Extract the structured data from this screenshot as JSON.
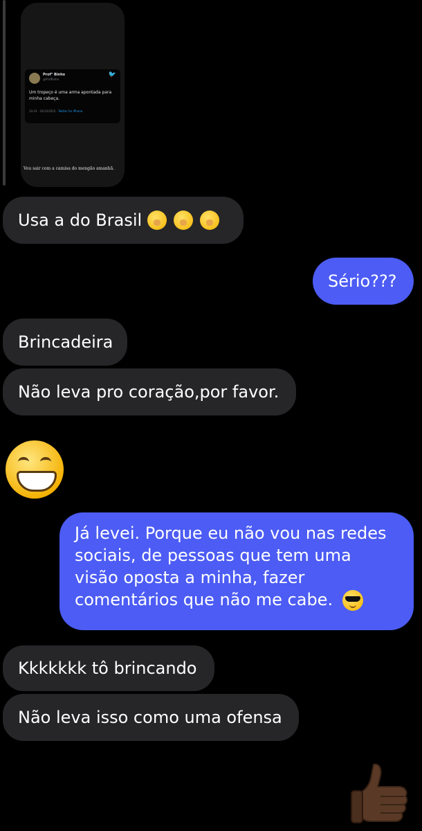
{
  "shared_media": {
    "tweet": {
      "name": "Prof° Binho",
      "handle": "@ProfBinho",
      "text": "Um tropeço é uma arma apontada para minha cabeça.",
      "meta": "10:43 · 20/10/2022 ·",
      "source": "Twitter for iPhone"
    },
    "caption": "Vou sair com a camisa do mengão amanhã."
  },
  "messages": [
    {
      "side": "in",
      "text": "Usa a do Brasil"
    },
    {
      "side": "out",
      "text": "Sério???"
    },
    {
      "side": "in",
      "text": "Brincadeira"
    },
    {
      "side": "in",
      "text": "Não leva pro coração,por favor."
    },
    {
      "side": "out",
      "text": "Já levei. Porque eu não vou nas redes sociais, de pessoas que tem uma visão oposta a minha, fazer comentários que não me cabe."
    },
    {
      "side": "in",
      "text": "Kkkkkkk tô brincando"
    },
    {
      "side": "in",
      "text": "Não leva isso como uma ofensa"
    }
  ],
  "emojis": {
    "msg0": [
      "hand-over-mouth-emoji",
      "hand-over-mouth-emoji",
      "hand-over-mouth-emoji"
    ],
    "msg4": "smiling-face-with-sunglasses-emoji",
    "big_reaction": "beaming-face-with-smiling-eyes-emoji",
    "thumbs": "thumbs-up-dark-skin-emoji"
  },
  "colors": {
    "background": "#000000",
    "incoming_bubble": "#262628",
    "outgoing_bubble": "#4c5cf4"
  }
}
